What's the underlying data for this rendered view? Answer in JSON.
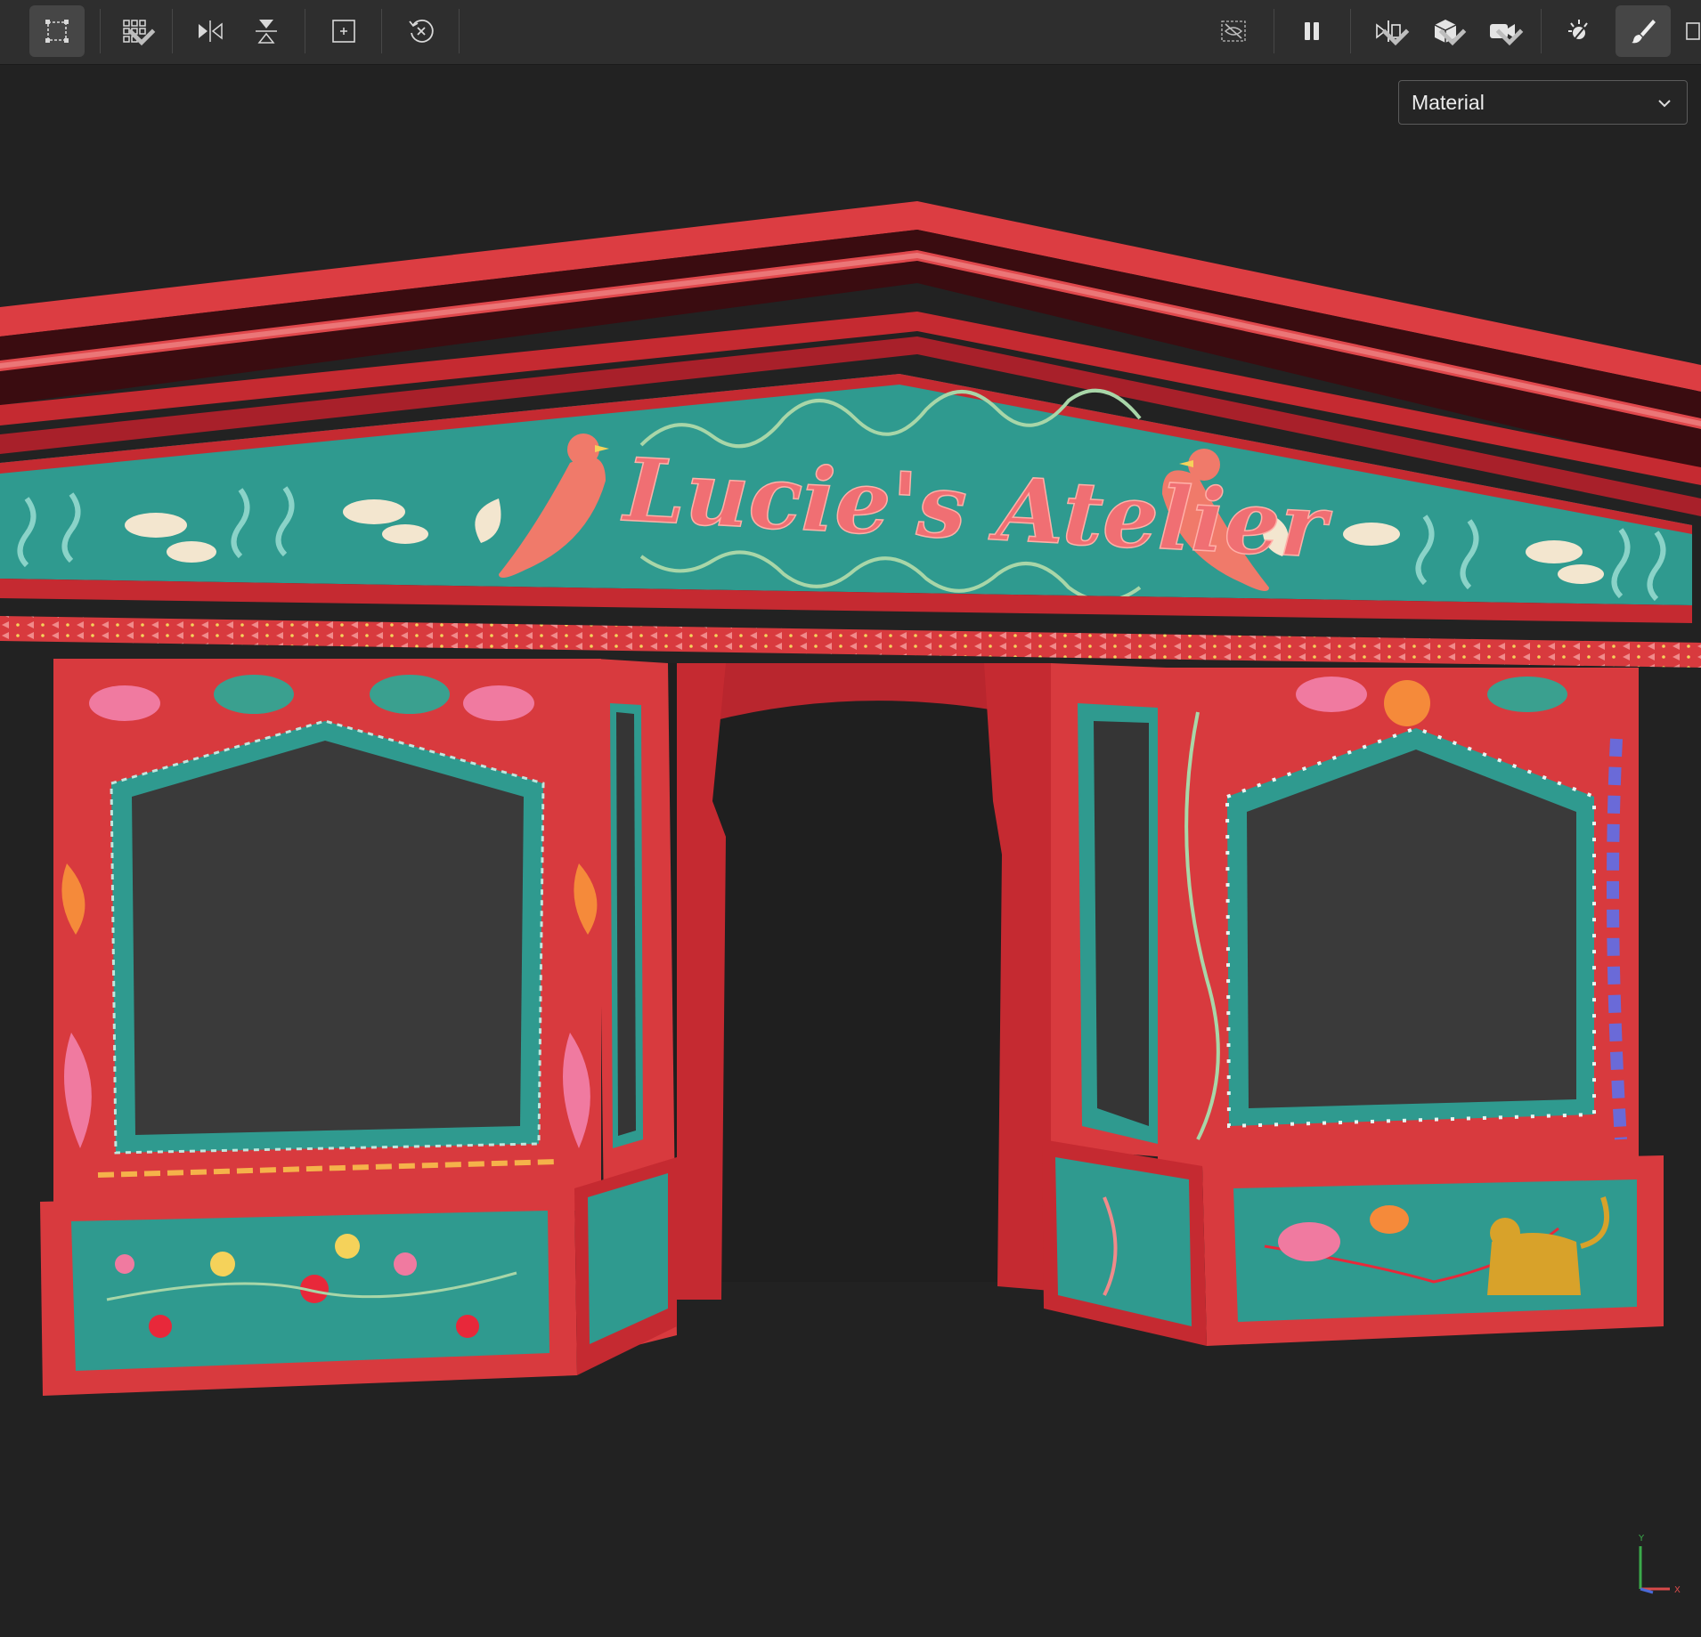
{
  "toolbar": {
    "left_tools": [
      {
        "id": "select-bounds",
        "icon": "select-bounds-icon",
        "active": true
      },
      {
        "id": "grid-select",
        "icon": "grid-icon",
        "has_menu": true
      },
      {
        "id": "flip-horizontal",
        "icon": "flip-horizontal-icon"
      },
      {
        "id": "flip-vertical",
        "icon": "flip-vertical-icon"
      },
      {
        "id": "frame-selection",
        "icon": "frame-icon"
      },
      {
        "id": "reset-transform",
        "icon": "reset-icon"
      }
    ],
    "right_tools": [
      {
        "id": "hide-toggle",
        "icon": "eye-hidden-icon"
      },
      {
        "id": "pause",
        "icon": "pause-icon"
      },
      {
        "id": "mirror-view",
        "icon": "mirror-icon",
        "has_menu": true
      },
      {
        "id": "object-view",
        "icon": "cube-icon",
        "has_menu": true
      },
      {
        "id": "camera",
        "icon": "camera-icon",
        "has_menu": true
      },
      {
        "id": "light-settings",
        "icon": "light-icon"
      },
      {
        "id": "paint-brush",
        "icon": "brush-icon",
        "active": true
      }
    ]
  },
  "view_mode": {
    "selected": "Material"
  },
  "scene": {
    "sign_text": "Lucie's Atelier",
    "colors": {
      "background": "#222222",
      "wood_red": "#d83a3e",
      "wood_dark": "#9e1e25",
      "teal": "#2f9a8f",
      "cream": "#f3e6cf",
      "window_glass": "#353535"
    }
  },
  "axes": {
    "y_label": "Y",
    "x_label": "X",
    "colors": {
      "y": "#3aaa4a",
      "x": "#d84a4a",
      "z": "#4a6ad8"
    }
  }
}
